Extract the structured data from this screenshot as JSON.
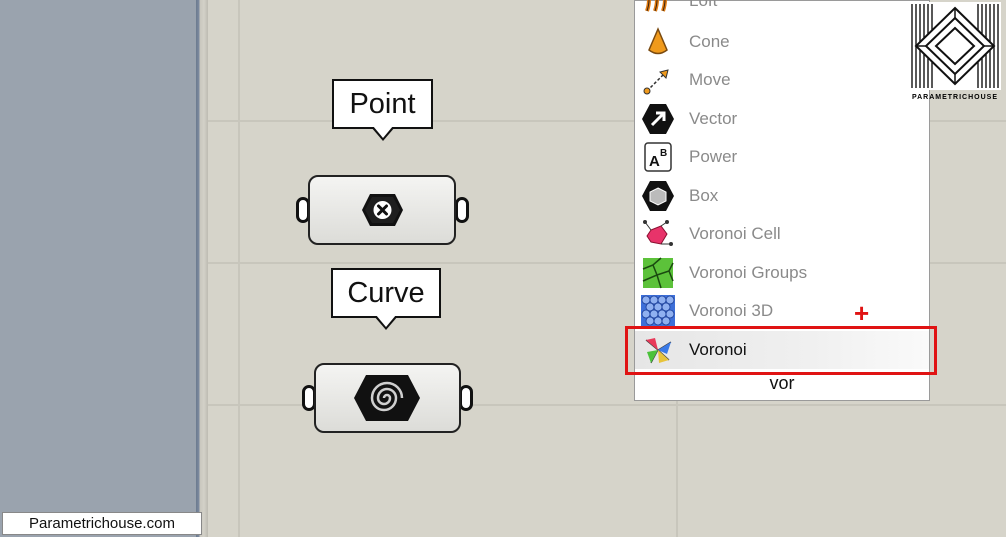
{
  "footer": {
    "label": "Parametrichouse.com"
  },
  "canvas": {
    "tooltips": {
      "point": "Point",
      "curve": "Curve"
    }
  },
  "popup": {
    "items": [
      {
        "label": "Loft",
        "icon": "loft-icon"
      },
      {
        "label": "Cone",
        "icon": "cone-icon"
      },
      {
        "label": "Move",
        "icon": "move-icon"
      },
      {
        "label": "Vector",
        "icon": "vector-icon"
      },
      {
        "label": "Power",
        "icon": "power-icon"
      },
      {
        "label": "Box",
        "icon": "box-icon"
      },
      {
        "label": "Voronoi Cell",
        "icon": "voronoi-cell-icon"
      },
      {
        "label": "Voronoi Groups",
        "icon": "voronoi-groups-icon"
      },
      {
        "label": "Voronoi 3D",
        "icon": "voronoi-3d-icon"
      },
      {
        "label": "Voronoi",
        "icon": "voronoi-icon",
        "selected": true
      }
    ],
    "search_text": "vor",
    "annotation_plus": "+"
  },
  "logo": {
    "text": "PARAMETRICHOUSE"
  },
  "colors": {
    "highlight": "#e01313",
    "canvas": "#d6d4ca",
    "panel": "#9aa3ae"
  }
}
